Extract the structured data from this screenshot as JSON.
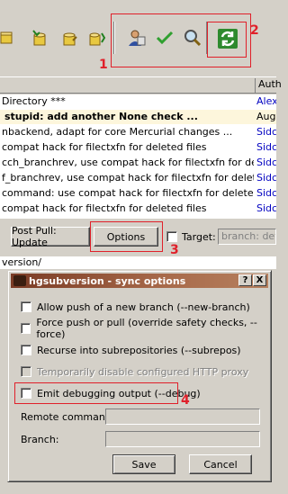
{
  "toolbar": {
    "icons": [
      "pull-icon",
      "pull-update-icon",
      "push-icon",
      "push-all-icon",
      "user-icon",
      "checkmark-icon",
      "search-icon",
      "sync-icon"
    ],
    "annotations": {
      "box1": "1",
      "box2": "2"
    }
  },
  "list": {
    "header_author": "Auth",
    "rows": [
      {
        "message": "Directory ***",
        "author": "Alex"
      },
      {
        "message": "stupid: add another None check ...",
        "author": "Aug"
      },
      {
        "message": "nbackend, adapt for core Mercurial changes ...",
        "author": "Sidc"
      },
      {
        "message": "compat hack for filectxfn for deleted files",
        "author": "Sidc"
      },
      {
        "message": "cch_branchrev, use compat hack for filectxfn for deleted fil...",
        "author": "Sidc"
      },
      {
        "message": "f_branchrev, use compat hack for filectxfn for deleted files",
        "author": "Sidc"
      },
      {
        "message": "command: use compat hack for filectxfn for deleted files",
        "author": "Sidc"
      },
      {
        "message": "compat hack for filectxfn for deleted files",
        "author": "Sidc"
      }
    ]
  },
  "bottom": {
    "post_pull_value": "Post Pull: Update",
    "options_label": "Options",
    "target_label": "Target:",
    "target_placeholder": "branch: defa",
    "annotation3": "3",
    "path_text": "version/"
  },
  "dialog": {
    "title": "hgsubversion - sync options",
    "help_label": "?",
    "close_label": "X",
    "options": [
      {
        "label": "Allow push of a new branch (--new-branch)",
        "enabled": true
      },
      {
        "label": "Force push or pull (override safety checks, --force)",
        "enabled": true
      },
      {
        "label": "Recurse into subrepositories (--subrepos)",
        "enabled": true
      },
      {
        "label": "Temporarily disable configured HTTP proxy",
        "enabled": false
      },
      {
        "label": "Emit debugging output (--debug)",
        "enabled": true
      }
    ],
    "annotation4": "4",
    "remote_command_label": "Remote command:",
    "branch_label": "Branch:",
    "save_label": "Save",
    "cancel_label": "Cancel"
  },
  "colors": {
    "annotation": "#e0202a",
    "titlebar": "#7a3b25",
    "author_link": "#0000c0",
    "selected_row": "#fdf6dc"
  }
}
